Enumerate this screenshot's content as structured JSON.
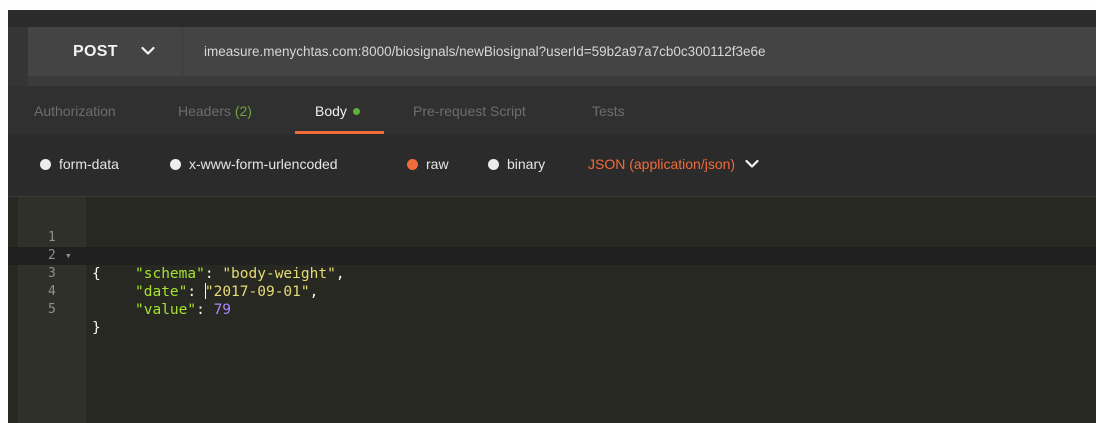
{
  "request": {
    "method": "POST",
    "url": "imeasure.menychtas.com:8000/biosignals/newBiosignal?userId=59b2a97a7cb0c300112f3e6e"
  },
  "tabs": {
    "authorization": "Authorization",
    "headers": "Headers",
    "headers_count": "(2)",
    "body": "Body",
    "prerequest": "Pre-request Script",
    "tests": "Tests"
  },
  "body_types": {
    "form_data": "form-data",
    "urlencoded": "x-www-form-urlencoded",
    "raw": "raw",
    "binary": "binary",
    "selected": "raw",
    "content_type": "JSON (application/json)"
  },
  "editor": {
    "line_numbers": [
      "1",
      "2",
      "3",
      "4",
      "5"
    ],
    "open_brace": "{",
    "close_brace": "}",
    "lines": [
      {
        "key": "\"schema\"",
        "sep": ": ",
        "value": "\"body-weight\"",
        "end": ","
      },
      {
        "key": "\"date\"",
        "sep": ": ",
        "value": "\"2017-09-01\"",
        "end": ","
      },
      {
        "key": "\"value\"",
        "sep": ": ",
        "value": "79",
        "end": ""
      }
    ]
  },
  "colors": {
    "accent": "#f26b3a",
    "active_dot": "#5fb236",
    "editor_bg": "#272822"
  }
}
